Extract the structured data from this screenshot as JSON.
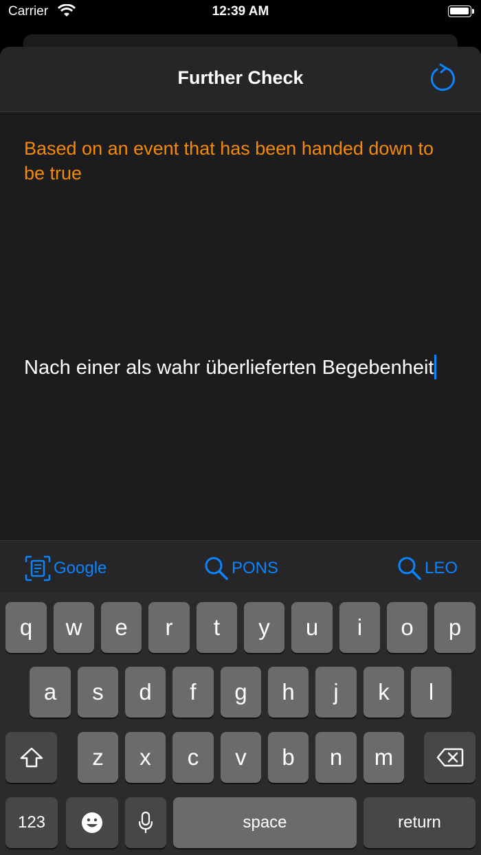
{
  "status": {
    "carrier": "Carrier",
    "time": "12:39 AM"
  },
  "nav": {
    "title": "Further Check",
    "refresh_icon": "refresh-icon"
  },
  "content": {
    "english": "Based on an event that has been handed down to be true",
    "german": "Nach einer als wahr überlieferten Begebenheit"
  },
  "toolbar": [
    {
      "label": "Google",
      "icon": "scan-text-icon"
    },
    {
      "label": "PONS",
      "icon": "search-icon"
    },
    {
      "label": "LEO",
      "icon": "search-icon"
    }
  ],
  "keyboard": {
    "row1": [
      "q",
      "w",
      "e",
      "r",
      "t",
      "y",
      "u",
      "i",
      "o",
      "p"
    ],
    "row2": [
      "a",
      "s",
      "d",
      "f",
      "g",
      "h",
      "j",
      "k",
      "l"
    ],
    "row3": [
      "z",
      "x",
      "c",
      "v",
      "b",
      "n",
      "m"
    ],
    "numbers_label": "123",
    "space_label": "space",
    "return_label": "return"
  },
  "colors": {
    "accent": "#0a84ff",
    "english_text": "#f58a07",
    "background": "#1c1c1e"
  }
}
